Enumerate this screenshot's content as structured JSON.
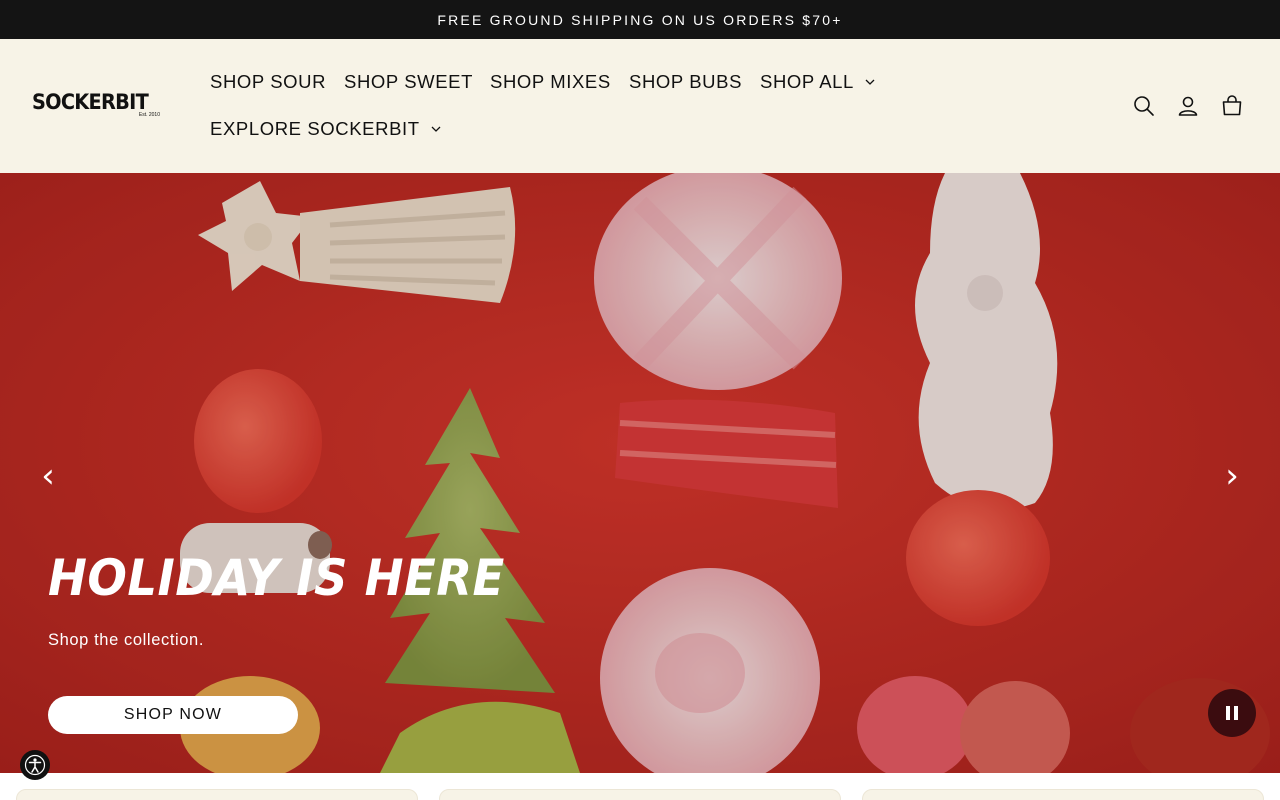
{
  "announcement": {
    "text": "FREE GROUND SHIPPING ON US ORDERS $70+"
  },
  "header": {
    "logo": {
      "wordmark": "SOCKERBIT",
      "tagline": "Est. 2010"
    },
    "nav": [
      {
        "label": "SHOP SOUR",
        "has_dropdown": false
      },
      {
        "label": "SHOP SWEET",
        "has_dropdown": false
      },
      {
        "label": "SHOP MIXES",
        "has_dropdown": false
      },
      {
        "label": "SHOP BUBS",
        "has_dropdown": false
      },
      {
        "label": "SHOP ALL",
        "has_dropdown": true
      },
      {
        "label": "EXPLORE SOCKERBIT",
        "has_dropdown": true
      }
    ],
    "icons": [
      "search-icon",
      "account-icon",
      "cart-icon"
    ],
    "background": "#f7f3e7"
  },
  "hero": {
    "title": "HOLIDAY IS HERE",
    "subtitle": "Shop the collection.",
    "button_label": "SHOP NOW",
    "prev_glyph": "‹",
    "next_glyph": "›",
    "background_color": "#c62d25",
    "pause_button_color": "#3b0c0f"
  },
  "colors": {
    "announcement_bg": "#141414",
    "text": "#111111"
  }
}
